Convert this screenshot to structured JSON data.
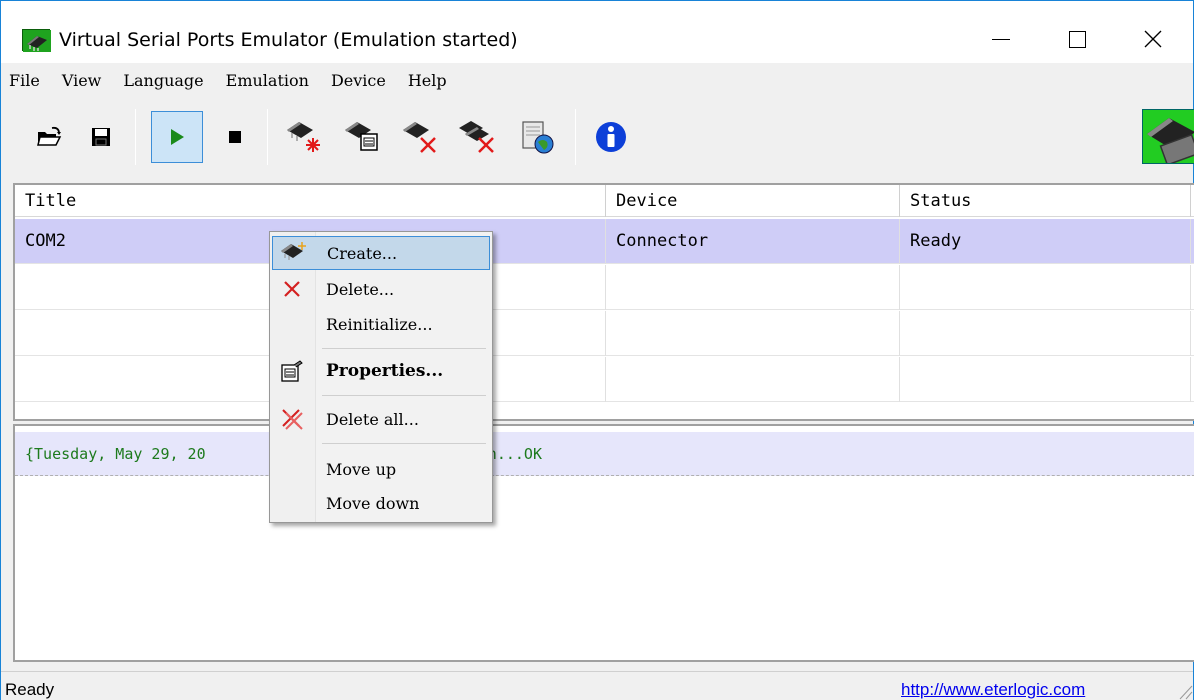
{
  "window": {
    "title": "Virtual Serial Ports Emulator (Emulation started)",
    "controls": {
      "minimize": "—",
      "maximize": "☐",
      "close": "✕"
    }
  },
  "menubar": {
    "items": [
      "File",
      "View",
      "Language",
      "Emulation",
      "Device",
      "Help"
    ]
  },
  "toolbar": {
    "buttons": [
      {
        "name": "open-icon"
      },
      {
        "name": "save-icon"
      },
      {
        "name": "start-emulation-icon",
        "active": true
      },
      {
        "name": "stop-emulation-icon"
      },
      {
        "name": "create-device-icon"
      },
      {
        "name": "device-properties-icon"
      },
      {
        "name": "delete-device-icon"
      },
      {
        "name": "delete-all-devices-icon"
      },
      {
        "name": "network-settings-icon"
      },
      {
        "name": "info-icon"
      }
    ]
  },
  "devices_table": {
    "columns": [
      "Title",
      "Device",
      "Status"
    ],
    "rows": [
      {
        "title": "COM2",
        "device": "Connector",
        "status": "Ready",
        "selected": true
      }
    ]
  },
  "log": {
    "lines": [
      "{Tuesday, May 29, 20",
      "ization...OK"
    ]
  },
  "context_menu": {
    "items": {
      "create": "Create...",
      "delete": "Delete...",
      "reinitialize": "Reinitialize...",
      "properties": "Properties...",
      "delete_all": "Delete all...",
      "move_up": "Move up",
      "move_down": "Move down"
    },
    "highlighted": "create"
  },
  "statusbar": {
    "status": "Ready",
    "link": "http://www.eterlogic.com"
  },
  "colors": {
    "selection_row": "#cfcdf7",
    "log_text": "#1d7a1d",
    "accent": "#3c8ed8",
    "link": "#0000ee"
  }
}
